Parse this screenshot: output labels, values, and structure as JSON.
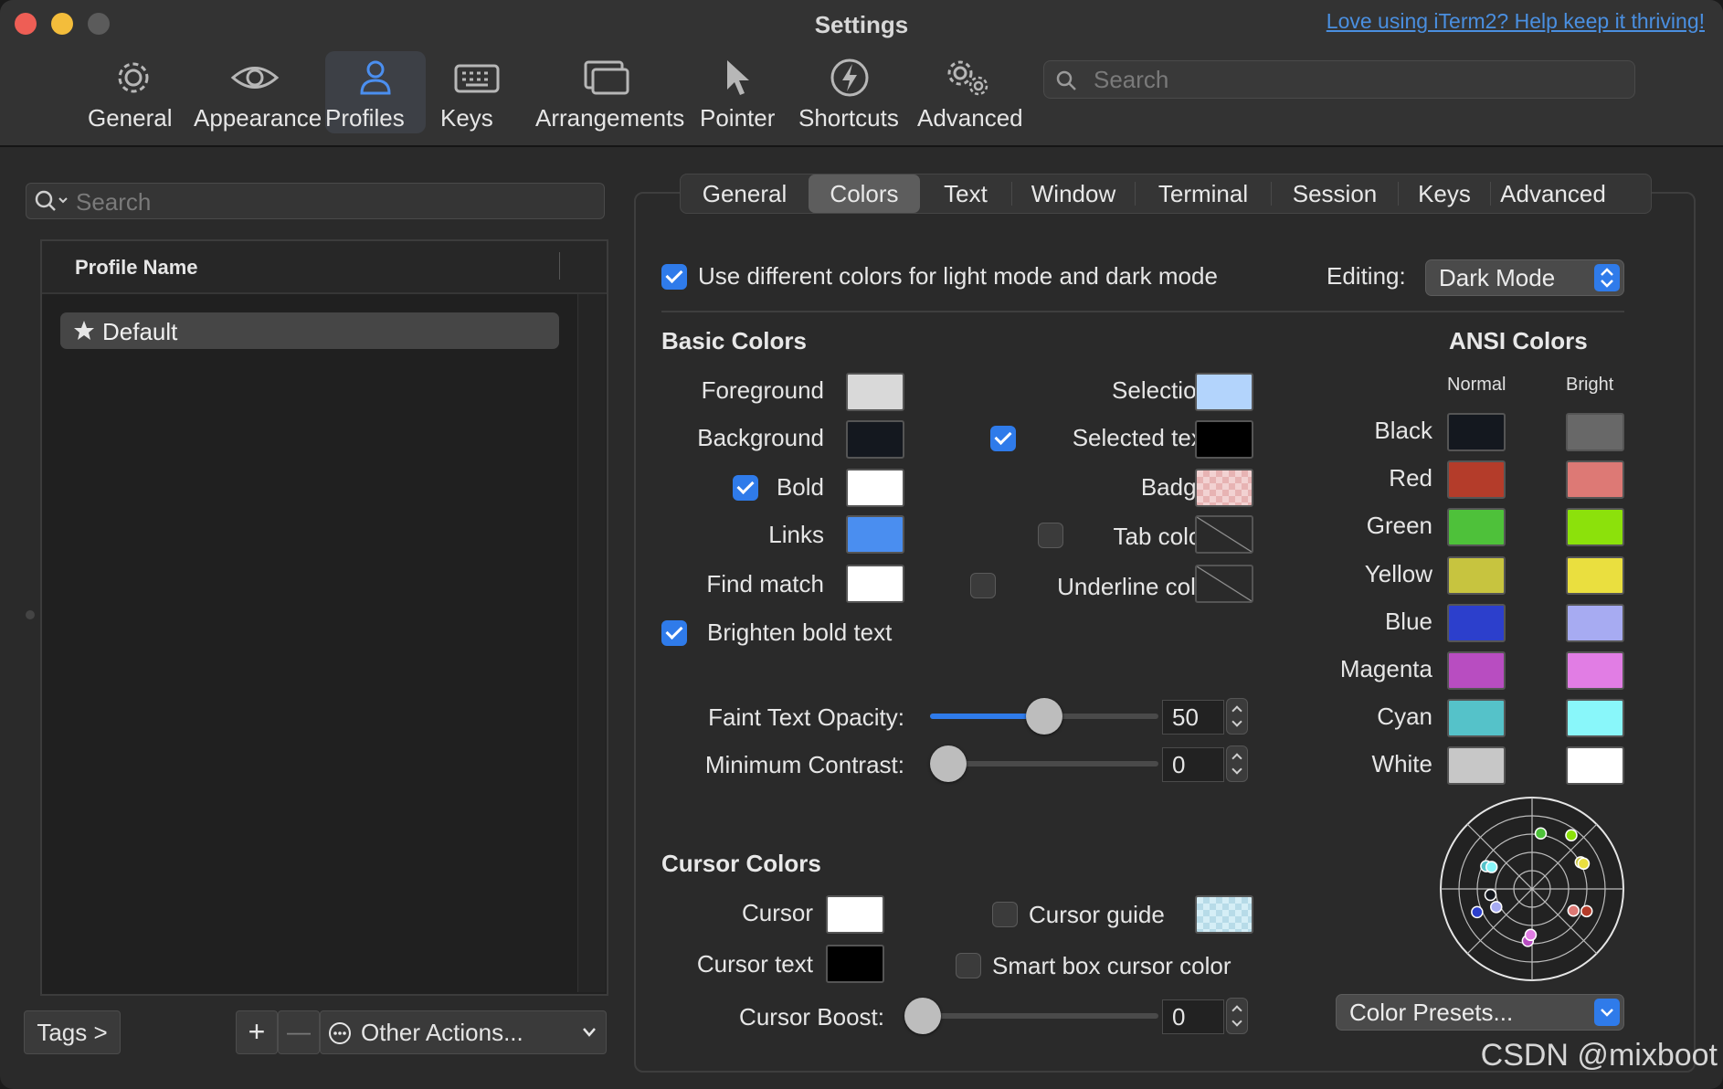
{
  "window": {
    "title": "Settings",
    "help_link": "Love using iTerm2? Help keep it thriving!"
  },
  "toolbar": {
    "items": [
      {
        "label": "General",
        "icon": "gear-icon"
      },
      {
        "label": "Appearance",
        "icon": "eye-icon"
      },
      {
        "label": "Profiles",
        "icon": "person-icon",
        "active": true
      },
      {
        "label": "Keys",
        "icon": "keyboard-icon"
      },
      {
        "label": "Arrangements",
        "icon": "windows-icon"
      },
      {
        "label": "Pointer",
        "icon": "cursor-icon"
      },
      {
        "label": "Shortcuts",
        "icon": "bolt-icon"
      },
      {
        "label": "Advanced",
        "icon": "gears-icon"
      }
    ],
    "search_placeholder": "Search"
  },
  "profiles_pane": {
    "search_placeholder": "Search",
    "column_header": "Profile Name",
    "profiles": [
      {
        "name": "Default",
        "default": true
      }
    ],
    "tags_button": "Tags >",
    "add_button": "+",
    "remove_button": "—",
    "other_actions": "Other Actions..."
  },
  "profile_tabs": {
    "items": [
      "General",
      "Colors",
      "Text",
      "Window",
      "Terminal",
      "Session",
      "Keys",
      "Advanced"
    ],
    "selected": "Colors"
  },
  "colors": {
    "different_modes_label": "Use different colors for light mode and dark mode",
    "different_modes_checked": true,
    "editing_label": "Editing:",
    "editing_value": "Dark Mode",
    "basic": {
      "title": "Basic Colors",
      "foreground": {
        "label": "Foreground",
        "color": "#d9d9d9"
      },
      "background": {
        "label": "Background",
        "color": "#14181f"
      },
      "bold": {
        "label": "Bold",
        "checked": true,
        "color": "#ffffff"
      },
      "links": {
        "label": "Links",
        "color": "#4a8ef0"
      },
      "find_match": {
        "label": "Find match",
        "color": "#ffffff"
      },
      "selection": {
        "label": "Selection",
        "color": "#b3d4fc"
      },
      "selected_text": {
        "label": "Selected text",
        "checked": true,
        "color": "#000000"
      },
      "badge": {
        "label": "Badge",
        "color": "checker-pink"
      },
      "tab_color": {
        "label": "Tab color",
        "checked": false
      },
      "underline_color": {
        "label": "Underline color",
        "checked": false
      },
      "brighten_bold": {
        "label": "Brighten bold text",
        "checked": true
      }
    },
    "faint_opacity": {
      "label": "Faint Text Opacity:",
      "value": "50",
      "fraction": 0.5
    },
    "min_contrast": {
      "label": "Minimum Contrast:",
      "value": "0",
      "fraction": 0
    },
    "cursor": {
      "title": "Cursor Colors",
      "cursor": {
        "label": "Cursor",
        "color": "#ffffff"
      },
      "cursor_text": {
        "label": "Cursor text",
        "color": "#000000"
      },
      "cursor_guide": {
        "label": "Cursor guide",
        "checked": false,
        "color": "checker-blue"
      },
      "smart_box": {
        "label": "Smart box cursor color",
        "checked": false
      },
      "boost": {
        "label": "Cursor Boost:",
        "value": "0",
        "fraction": 0
      }
    },
    "ansi": {
      "title": "ANSI Colors",
      "normal_header": "Normal",
      "bright_header": "Bright",
      "rows": [
        {
          "name": "Black",
          "normal": "#14181f",
          "bright": "#686868"
        },
        {
          "name": "Red",
          "normal": "#b43c2a",
          "bright": "#dd7975"
        },
        {
          "name": "Green",
          "normal": "#4ec13a",
          "bright": "#8ce10b"
        },
        {
          "name": "Yellow",
          "normal": "#c7c43f",
          "bright": "#eadf3f"
        },
        {
          "name": "Blue",
          "normal": "#2c3fcc",
          "bright": "#a7abf2"
        },
        {
          "name": "Magenta",
          "normal": "#b84dc1",
          "bright": "#e17de4"
        },
        {
          "name": "Cyan",
          "normal": "#55c2c9",
          "bright": "#89f7fa"
        },
        {
          "name": "White",
          "normal": "#c7c7c7",
          "bright": "#ffffff"
        }
      ]
    },
    "color_presets": "Color Presets..."
  },
  "watermark": "CSDN @mixboot"
}
